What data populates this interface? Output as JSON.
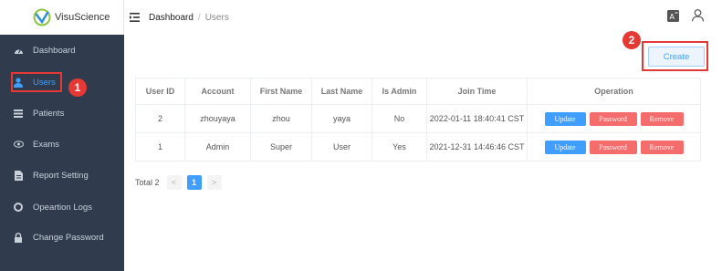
{
  "app": {
    "logo_text": "VisuScience"
  },
  "sidebar": {
    "items": [
      {
        "label": "Dashboard",
        "icon": "dashboard-icon"
      },
      {
        "label": "Users",
        "icon": "user-icon",
        "active": true
      },
      {
        "label": "Patients",
        "icon": "list-icon"
      },
      {
        "label": "Exams",
        "icon": "eye-icon"
      },
      {
        "label": "Report Setting",
        "icon": "document-icon"
      },
      {
        "label": "Opeartion Logs",
        "icon": "log-icon"
      },
      {
        "label": "Change Password",
        "icon": "lock-icon"
      }
    ]
  },
  "header": {
    "breadcrumb": [
      "Dashboard",
      "Users"
    ],
    "separator": "/"
  },
  "annotations": {
    "marker1": "1",
    "marker2": "2"
  },
  "toolbar": {
    "create_label": "Create"
  },
  "table": {
    "columns": [
      "User ID",
      "Account",
      "First Name",
      "Last Name",
      "Is Admin",
      "Join Time",
      "Operation"
    ],
    "rows": [
      {
        "id": "2",
        "account": "zhouyaya",
        "first": "zhou",
        "last": "yaya",
        "admin": "No",
        "join": "2022-01-11 18:40:41 CST"
      },
      {
        "id": "1",
        "account": "Admin",
        "first": "Super",
        "last": "User",
        "admin": "Yes",
        "join": "2021-12-31 14:46:46 CST"
      }
    ],
    "actions": {
      "update": "Update",
      "password": "Password",
      "remove": "Remove"
    }
  },
  "pagination": {
    "total": "Total 2",
    "prev": "<",
    "current": "1",
    "next": ">"
  },
  "colors": {
    "sidebar_bg": "#303c4d",
    "primary": "#409eff",
    "danger": "#f56c6c",
    "annotation": "#e53935"
  }
}
